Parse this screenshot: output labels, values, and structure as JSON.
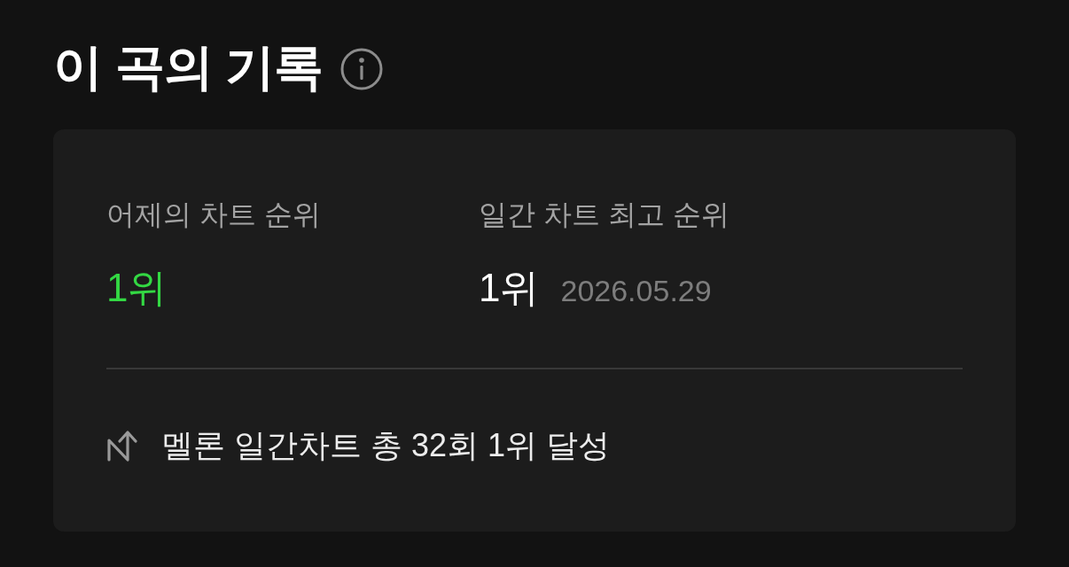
{
  "header": {
    "title": "이 곡의 기록"
  },
  "stats": [
    {
      "label": "어제의 차트 순위",
      "value": "1위",
      "color": "#33d843"
    },
    {
      "label": "일간 차트 최고 순위",
      "value": "1위",
      "color": "#ffffff",
      "date": "2026.05.29"
    }
  ],
  "achievement": {
    "text": "멜론 일간차트 총 32회 1위 달성"
  }
}
